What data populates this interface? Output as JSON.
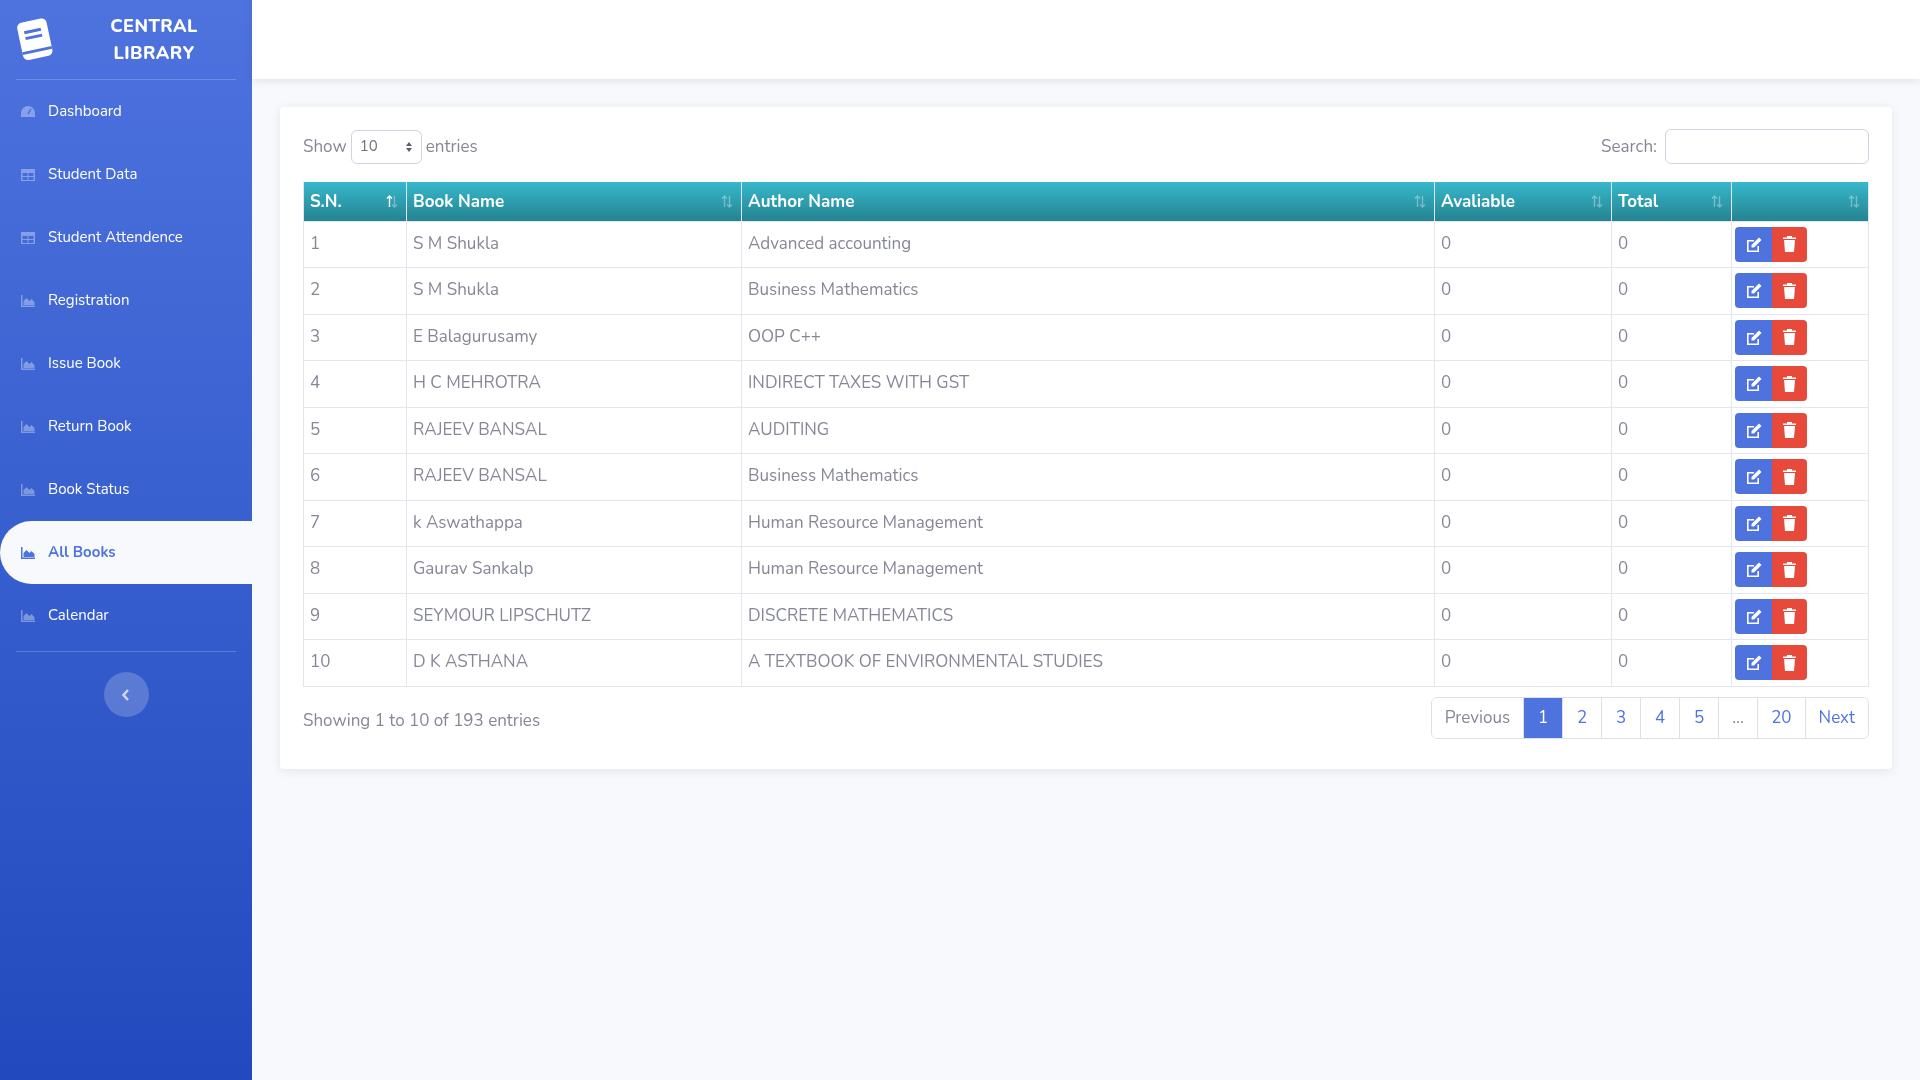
{
  "sidebar": {
    "brand": [
      "CENTRAL",
      "LIBRARY"
    ],
    "items": [
      {
        "label": "Dashboard",
        "kind": "gauge",
        "selected": false
      },
      {
        "label": "Student Data",
        "kind": "table",
        "selected": false
      },
      {
        "label": "Student Attendence",
        "kind": "table",
        "selected": false
      },
      {
        "label": "Registration",
        "kind": "chart",
        "selected": false
      },
      {
        "label": "Issue Book",
        "kind": "chart",
        "selected": false
      },
      {
        "label": "Return Book",
        "kind": "chart",
        "selected": false
      },
      {
        "label": "Book Status",
        "kind": "chart",
        "selected": false
      },
      {
        "label": "All Books",
        "kind": "chart",
        "selected": true
      },
      {
        "label": "Calendar",
        "kind": "chart",
        "selected": false
      }
    ]
  },
  "table_controls": {
    "show_label": "Show",
    "page_size": "10",
    "entries_label": "entries",
    "search_label": "Search:"
  },
  "table": {
    "columns": [
      {
        "label": "S.N.",
        "sorted": true
      },
      {
        "label": "Book Name",
        "sorted": false
      },
      {
        "label": "Author Name",
        "sorted": false
      },
      {
        "label": "Avaliable",
        "sorted": false
      },
      {
        "label": "Total",
        "sorted": false
      },
      {
        "sorted": false
      }
    ],
    "rows": [
      [
        "1",
        "S M Shukla",
        "Advanced accounting",
        "0",
        "0"
      ],
      [
        "2",
        "S M Shukla",
        "Business Mathematics",
        "0",
        "0"
      ],
      [
        "3",
        "E Balagurusamy",
        "OOP C++",
        "0",
        "0"
      ],
      [
        "4",
        "H C MEHROTRA",
        "INDIRECT TAXES WITH GST",
        "0",
        "0"
      ],
      [
        "5",
        "RAJEEV BANSAL",
        "AUDITING",
        "0",
        "0"
      ],
      [
        "6",
        "RAJEEV BANSAL",
        "Business Mathematics",
        "0",
        "0"
      ],
      [
        "7",
        "k Aswathappa",
        "Human Resource Management",
        "0",
        "0"
      ],
      [
        "8",
        "Gaurav Sankalp",
        "Human Resource Management",
        "0",
        "0"
      ],
      [
        "9",
        "SEYMOUR LIPSCHUTZ",
        "DISCRETE MATHEMATICS",
        "0",
        "0"
      ],
      [
        "10",
        "D K ASTHANA",
        "A TEXTBOOK OF ENVIRONMENTAL STUDIES",
        "0",
        "0"
      ]
    ]
  },
  "footer": {
    "info": "Showing 1 to 10 of 193 entries",
    "pagination": [
      {
        "label": "Previous",
        "selected": false,
        "disabled": true
      },
      {
        "label": "1",
        "selected": true,
        "disabled": false
      },
      {
        "label": "2",
        "selected": false,
        "disabled": false
      },
      {
        "label": "3",
        "selected": false,
        "disabled": false
      },
      {
        "label": "4",
        "selected": false,
        "disabled": false
      },
      {
        "label": "5",
        "selected": false,
        "disabled": false
      },
      {
        "label": "…",
        "selected": false,
        "disabled": true
      },
      {
        "label": "20",
        "selected": false,
        "disabled": false
      },
      {
        "label": "Next",
        "selected": false,
        "disabled": false
      }
    ]
  }
}
